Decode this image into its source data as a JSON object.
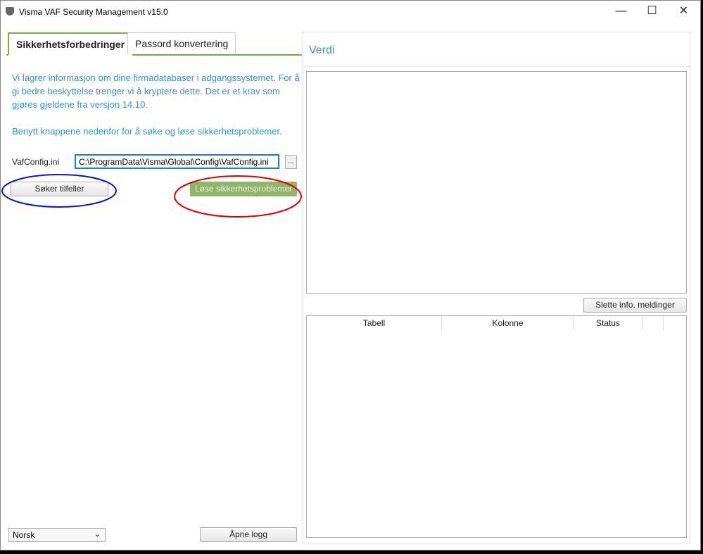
{
  "window": {
    "title": "Visma VAF Security Management v15.0",
    "minimize": "—",
    "maximize": "☐",
    "close": "✕"
  },
  "tabs": [
    {
      "label": "Sikkerhetsforbedringer"
    },
    {
      "label": "Passord konvertering"
    }
  ],
  "info": {
    "para1": "Vi lagrer informasjon om dine firmadatabaser i adgangssystemet. For å gi bedre beskyttelse trenger vi å kryptere dette. Det er et krav som gjøres gjeldene fra versjon 14.10.",
    "para2": "Benytt knappene nedenfor for å søke og løse sikkerhetsproblemer."
  },
  "config": {
    "label": "VafConfig.ini",
    "value": "C:\\ProgramData\\Visma\\Global\\Config\\VafConfig.ini",
    "browse": "..."
  },
  "buttons": {
    "search": "Søker tilfeller",
    "fix": "Løse sikkerhetsproblemer",
    "open_log": "Åpne logg",
    "clear": "Slette info. meldinger"
  },
  "language": {
    "selected": "Norsk"
  },
  "right": {
    "title": "Verdi",
    "columns": [
      "Tabell",
      "Kolonne",
      "Status",
      ""
    ]
  },
  "annotation_colors": {
    "blue": "#0a14d0",
    "red": "#e00000"
  }
}
